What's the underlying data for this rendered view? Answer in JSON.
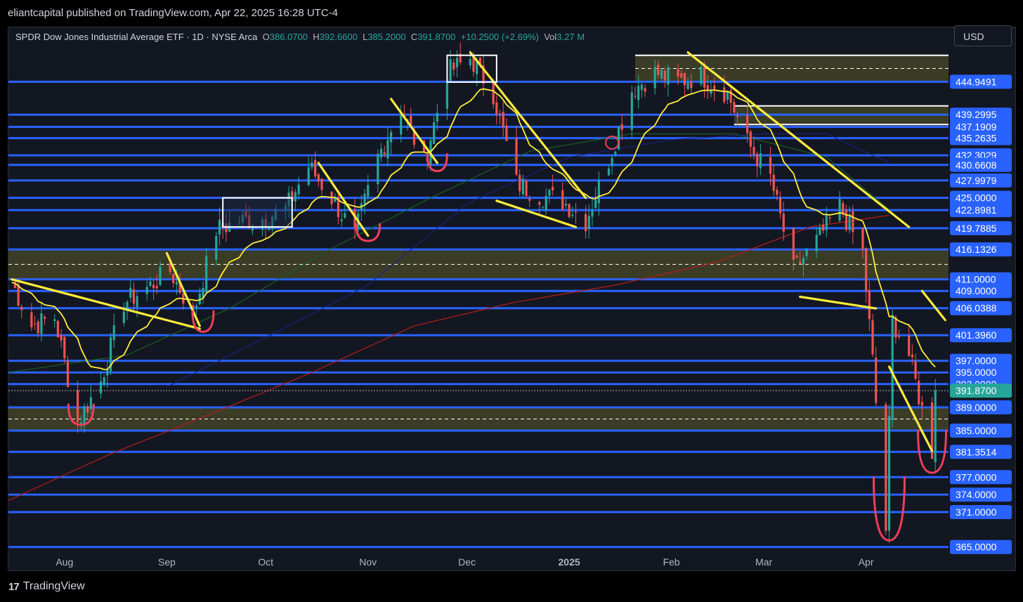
{
  "header": {
    "published": "eliantcapital published on TradingView.com, Apr 22, 2025 16:28 UTC-4"
  },
  "legend": {
    "symbol": "SPDR Dow Jones Industrial Average ETF · 1D · NYSE Arca",
    "o_label": "O",
    "o_value": "386.0700",
    "h_label": "H",
    "h_value": "392.6600",
    "l_label": "L",
    "l_value": "385.2000",
    "c_label": "C",
    "c_value": "391.8700",
    "change": "+10.2500 (+2.69%)",
    "vol_label": "Vol",
    "vol_value": "3.27 M"
  },
  "currency_button": {
    "label": "USD"
  },
  "footer": {
    "brand": "TradingView",
    "logo_icon": "tradingview-logo-icon"
  },
  "colors": {
    "background": "#131722",
    "bull": "#26a69a",
    "bear": "#ef5350",
    "level_line": "#2962ff",
    "zone_fill": "#4a4a28",
    "zone_border": "#ffffff",
    "annotation": "#ffeb3b",
    "annotation_red": "#ef3f5a",
    "sma_green": "#1b5e20",
    "sma_blue": "#1a237e",
    "sma_red": "#b71c1c",
    "last_price_bg": "#26a69a"
  },
  "chart_data": {
    "type": "candlestick",
    "symbol": "DIA",
    "timeframe": "1D",
    "y_axis": {
      "range": [
        364,
        452
      ],
      "tick_labels": [
        {
          "value": 444.9491,
          "label": "444.9491"
        },
        {
          "value": 439.2995,
          "label": "439.2995"
        },
        {
          "value": 437.1909,
          "label": "437.1909"
        },
        {
          "value": 435.2635,
          "label": "435.2635"
        },
        {
          "value": 432.3029,
          "label": "432.3029"
        },
        {
          "value": 430.6608,
          "label": "430.6608"
        },
        {
          "value": 427.9979,
          "label": "427.9979"
        },
        {
          "value": 425.0,
          "label": "425.0000"
        },
        {
          "value": 422.8981,
          "label": "422.8981"
        },
        {
          "value": 419.7885,
          "label": "419.7885"
        },
        {
          "value": 416.1326,
          "label": "416.1326"
        },
        {
          "value": 411.0,
          "label": "411.0000"
        },
        {
          "value": 409.0,
          "label": "409.0000"
        },
        {
          "value": 406.0388,
          "label": "406.0388"
        },
        {
          "value": 401.396,
          "label": "401.3960"
        },
        {
          "value": 397.0,
          "label": "397.0000"
        },
        {
          "value": 395.0,
          "label": "395.0000"
        },
        {
          "value": 393.0,
          "label": "393.0000"
        },
        {
          "value": 389.0,
          "label": "389.0000"
        },
        {
          "value": 385.0,
          "label": "385.0000"
        },
        {
          "value": 381.3514,
          "label": "381.3514"
        },
        {
          "value": 377.0,
          "label": "377.0000"
        },
        {
          "value": 374.0,
          "label": "374.0000"
        },
        {
          "value": 371.0,
          "label": "371.0000"
        },
        {
          "value": 365.0,
          "label": "365.0000"
        }
      ],
      "last_price": {
        "value": 391.87,
        "label": "391.8700"
      }
    },
    "x_axis": {
      "labels": [
        "Aug",
        "Sep",
        "Oct",
        "Nov",
        "Dec",
        "2025",
        "Feb",
        "Mar",
        "Apr"
      ],
      "bold_label": "2025"
    },
    "horizontal_levels": [
      444.9491,
      439.2995,
      437.1909,
      435.2635,
      432.3029,
      430.6608,
      427.9979,
      425.0,
      422.8981,
      419.7885,
      416.1326,
      411.0,
      409.0,
      406.0388,
      401.396,
      397.0,
      395.0,
      393.0,
      389.0,
      385.0,
      381.3514,
      377.0,
      374.0,
      371.0,
      365.0
    ],
    "zones": [
      {
        "top": 416.1326,
        "bottom": 411.0,
        "x_start": "start",
        "x_end": "end"
      },
      {
        "top": 389.0,
        "bottom": 385.0,
        "x_start": "start",
        "x_end": "end"
      },
      {
        "top": 449.5,
        "bottom": 444.9491,
        "x_start": "Feb",
        "x_end": "end"
      },
      {
        "top": 440.8,
        "bottom": 437.6,
        "x_start": "Mar",
        "x_end": "end"
      }
    ],
    "moving_averages": [
      {
        "color": "yellow",
        "length": "short"
      },
      {
        "color": "green",
        "length": "medium"
      },
      {
        "color": "blue",
        "length": "long"
      },
      {
        "color": "red",
        "length": "longest"
      }
    ],
    "price_path": [
      {
        "date": "2024-07-16",
        "close": 410.5
      },
      {
        "date": "2024-07-22",
        "close": 403.0
      },
      {
        "date": "2024-07-29",
        "close": 404.5
      },
      {
        "date": "2024-08-05",
        "close": 386.5
      },
      {
        "date": "2024-08-12",
        "close": 393.5
      },
      {
        "date": "2024-08-19",
        "close": 407.0
      },
      {
        "date": "2024-08-26",
        "close": 409.5
      },
      {
        "date": "2024-09-02",
        "close": 412.5
      },
      {
        "date": "2024-09-09",
        "close": 405.0
      },
      {
        "date": "2024-09-16",
        "close": 419.5
      },
      {
        "date": "2024-09-23",
        "close": 421.0
      },
      {
        "date": "2024-09-30",
        "close": 421.5
      },
      {
        "date": "2024-10-07",
        "close": 423.0
      },
      {
        "date": "2024-10-14",
        "close": 430.5
      },
      {
        "date": "2024-10-21",
        "close": 425.0
      },
      {
        "date": "2024-10-28",
        "close": 418.5
      },
      {
        "date": "2024-11-04",
        "close": 432.0
      },
      {
        "date": "2024-11-11",
        "close": 440.5
      },
      {
        "date": "2024-11-18",
        "close": 431.0
      },
      {
        "date": "2024-11-25",
        "close": 446.5
      },
      {
        "date": "2024-12-02",
        "close": 449.0
      },
      {
        "date": "2024-12-09",
        "close": 443.0
      },
      {
        "date": "2024-12-16",
        "close": 427.5
      },
      {
        "date": "2024-12-23",
        "close": 425.5
      },
      {
        "date": "2024-12-30",
        "close": 424.5
      },
      {
        "date": "2025-01-06",
        "close": 421.0
      },
      {
        "date": "2025-01-13",
        "close": 431.5
      },
      {
        "date": "2025-01-20",
        "close": 443.5
      },
      {
        "date": "2025-01-27",
        "close": 446.5
      },
      {
        "date": "2025-02-03",
        "close": 445.0
      },
      {
        "date": "2025-02-10",
        "close": 446.0
      },
      {
        "date": "2025-02-18",
        "close": 443.0
      },
      {
        "date": "2025-02-24",
        "close": 434.5
      },
      {
        "date": "2025-03-03",
        "close": 428.5
      },
      {
        "date": "2025-03-10",
        "close": 412.5
      },
      {
        "date": "2025-03-17",
        "close": 417.5
      },
      {
        "date": "2025-03-24",
        "close": 423.5
      },
      {
        "date": "2025-03-31",
        "close": 415.5
      },
      {
        "date": "2025-04-03",
        "close": 397.0
      },
      {
        "date": "2025-04-07",
        "close": 368.0
      },
      {
        "date": "2025-04-09",
        "close": 404.0
      },
      {
        "date": "2025-04-14",
        "close": 398.0
      },
      {
        "date": "2025-04-21",
        "close": 381.5
      },
      {
        "date": "2025-04-22",
        "close": 391.87
      }
    ]
  }
}
